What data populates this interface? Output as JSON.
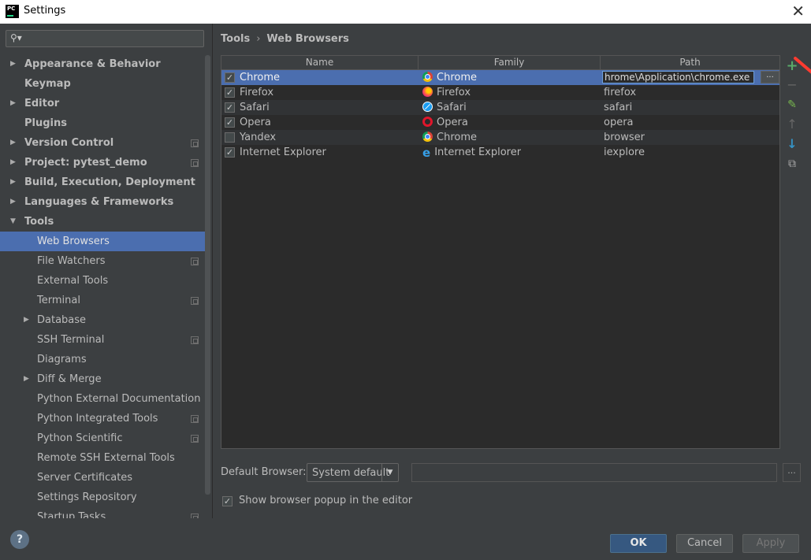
{
  "window": {
    "title": "Settings",
    "app_icon_text": "PC"
  },
  "sidebar": {
    "search_placeholder": "",
    "items": [
      {
        "label": "Appearance & Behavior"
      },
      {
        "label": "Keymap"
      },
      {
        "label": "Editor"
      },
      {
        "label": "Plugins"
      },
      {
        "label": "Version Control"
      },
      {
        "label": "Project: pytest_demo"
      },
      {
        "label": "Build, Execution, Deployment"
      },
      {
        "label": "Languages & Frameworks"
      },
      {
        "label": "Tools"
      },
      {
        "label": "Web Browsers"
      },
      {
        "label": "File Watchers"
      },
      {
        "label": "External Tools"
      },
      {
        "label": "Terminal"
      },
      {
        "label": "Database"
      },
      {
        "label": "SSH Terminal"
      },
      {
        "label": "Diagrams"
      },
      {
        "label": "Diff & Merge"
      },
      {
        "label": "Python External Documentation"
      },
      {
        "label": "Python Integrated Tools"
      },
      {
        "label": "Python Scientific"
      },
      {
        "label": "Remote SSH External Tools"
      },
      {
        "label": "Server Certificates"
      },
      {
        "label": "Settings Repository"
      },
      {
        "label": "Startup Tasks"
      }
    ]
  },
  "breadcrumb": {
    "parent": "Tools",
    "separator": "›",
    "current": "Web Browsers"
  },
  "table": {
    "headers": {
      "name": "Name",
      "family": "Family",
      "path": "Path"
    },
    "rows": [
      {
        "checked": "✓",
        "name": "Chrome",
        "family": "Chrome",
        "family_icon": "chrome-icon",
        "path": "hrome\\Application\\chrome.exe"
      },
      {
        "checked": "✓",
        "name": "Firefox",
        "family": "Firefox",
        "family_icon": "firefox-icon",
        "path": "firefox"
      },
      {
        "checked": "✓",
        "name": "Safari",
        "family": "Safari",
        "family_icon": "safari-icon",
        "path": "safari"
      },
      {
        "checked": "✓",
        "name": "Opera",
        "family": "Opera",
        "family_icon": "opera-icon",
        "path": "opera"
      },
      {
        "checked": "",
        "name": "Yandex",
        "family": "Chrome",
        "family_icon": "chrome-icon",
        "path": "browser"
      },
      {
        "checked": "✓",
        "name": "Internet Explorer",
        "family": "Internet Explorer",
        "family_icon": "ie-icon",
        "path": "iexplore"
      }
    ],
    "browse_label": "..."
  },
  "toolbar": {
    "add": "+",
    "remove": "−",
    "edit": "✎",
    "move_up": "↑",
    "move_down": "↓",
    "copy": "⧉"
  },
  "default_browser": {
    "label": "Default Browser:",
    "value": "System default",
    "path": "",
    "browse_label": "..."
  },
  "popup": {
    "checked": "✓",
    "label": "Show browser popup in the editor"
  },
  "buttons": {
    "help": "?",
    "ok": "OK",
    "cancel": "Cancel",
    "apply": "Apply"
  },
  "colors": {
    "accent": "#4b6eaf",
    "annotation_arrow": "#ff3b30",
    "add_icon": "#59a869",
    "down_icon": "#3592c4"
  }
}
